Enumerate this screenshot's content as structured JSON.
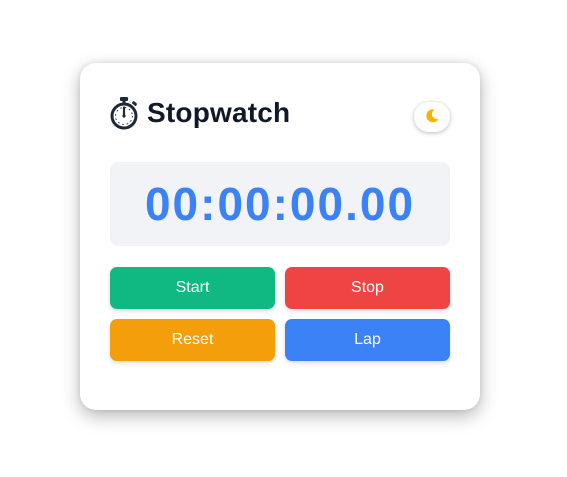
{
  "header": {
    "title": "Stopwatch",
    "icon": "stopwatch-icon"
  },
  "theme_toggle": {
    "icon": "moon-icon",
    "icon_color": "#f5b400"
  },
  "display": {
    "time": "00:00:00.00",
    "color": "#3b82f6"
  },
  "buttons": {
    "start": {
      "label": "Start",
      "color": "#10b981"
    },
    "stop": {
      "label": "Stop",
      "color": "#ef4444"
    },
    "reset": {
      "label": "Reset",
      "color": "#f59e0b"
    },
    "lap": {
      "label": "Lap",
      "color": "#3b82f6"
    }
  }
}
